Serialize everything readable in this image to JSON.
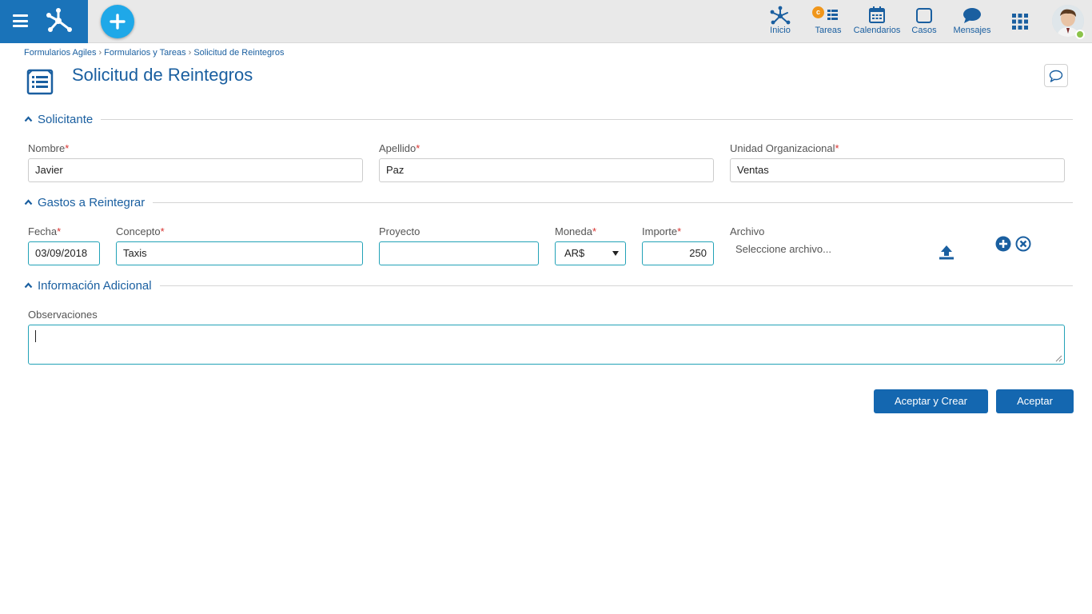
{
  "topbar": {
    "nav": [
      {
        "label": "Inicio",
        "icon": "network-icon"
      },
      {
        "label": "Tareas",
        "icon": "tasks-icon",
        "badge": "c"
      },
      {
        "label": "Calendarios",
        "icon": "calendar-icon"
      },
      {
        "label": "Casos",
        "icon": "case-icon"
      },
      {
        "label": "Mensajes",
        "icon": "chat-bubble-icon"
      }
    ],
    "colors": {
      "brand": "#1a73b9",
      "fab": "#1fa8e8",
      "badge": "#f0961a",
      "status": "#8bc34a"
    }
  },
  "breadcrumb": [
    "Formularios Agiles",
    "Formularios y Tareas",
    "Solicitud de Reintegros"
  ],
  "page": {
    "title": "Solicitud de Reintegros"
  },
  "sections": {
    "solicitante": {
      "title": "Solicitante",
      "nombre": {
        "label": "Nombre",
        "value": "Javier"
      },
      "apellido": {
        "label": "Apellido",
        "value": "Paz"
      },
      "unidad": {
        "label": "Unidad Organizacional",
        "value": "Ventas"
      }
    },
    "gastos": {
      "title": "Gastos a Reintegrar",
      "fecha": {
        "label": "Fecha",
        "value": "03/09/2018"
      },
      "concepto": {
        "label": "Concepto",
        "value": "Taxis"
      },
      "proyecto": {
        "label": "Proyecto",
        "value": ""
      },
      "moneda": {
        "label": "Moneda",
        "value": "AR$"
      },
      "importe": {
        "label": "Importe",
        "value": "250"
      },
      "archivo": {
        "label": "Archivo",
        "placeholder": "Seleccione archivo..."
      }
    },
    "adicional": {
      "title": "Información Adicional",
      "observaciones": {
        "label": "Observaciones",
        "value": ""
      }
    }
  },
  "required_mark": "*",
  "buttons": {
    "accept_create": "Aceptar y Crear",
    "accept": "Aceptar"
  },
  "accent_colors": {
    "link": "#1a5fa0",
    "focus": "#22a2b7",
    "button": "#1467b0",
    "required": "#d9322f"
  }
}
